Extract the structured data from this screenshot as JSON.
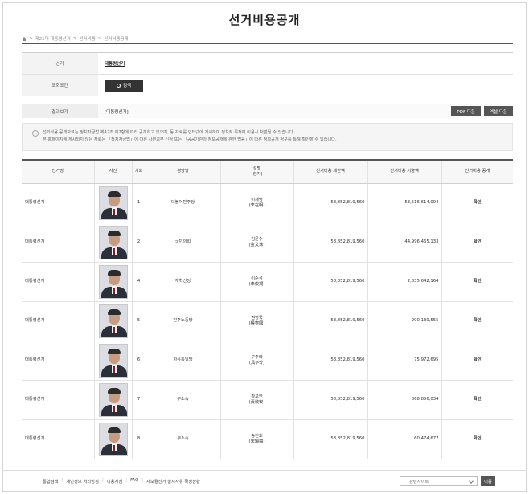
{
  "page": {
    "title": "선거비용공개"
  },
  "breadcrumb": [
    "제21대 대통령선거",
    "선거비용",
    "선거비용공개"
  ],
  "search": {
    "election_label": "선거",
    "election_value": "대통령선거",
    "condition_label": "조회조건",
    "search_button": "검색"
  },
  "result": {
    "label": "결과보기",
    "value": "[대통령선거]",
    "pdf_button": "PDF 다운",
    "excel_button": "엑셀 다운"
  },
  "notice": {
    "line1": "선거비용 공개자료는 정치자금법 제42조 제2항에 따라 공개하고 있으며, 동 자료를 인터넷에 게시하여 정치적 목적에 이용시 처벌될 수 있습니다.",
    "line2": "본 홈페이지에 게시되지 않은 자료는 「정치자금법」에 따른 사본교부 신청 또는 「공공기관의 정보공개에 관한 법률」에 따른 정보공개 청구를 통해 확인할 수 있습니다."
  },
  "table": {
    "headers": {
      "election": "선거명",
      "photo": "사진",
      "number": "기호",
      "party": "정당명",
      "name": "성명",
      "name_sub": "(한자)",
      "limit": "선거비용 제한액",
      "spent": "선거비용 지출액",
      "disclose": "선거비용 공개"
    },
    "rows": [
      {
        "election": "대통령선거",
        "number": "1",
        "party": "더불어민주당",
        "name": "이재명",
        "hanja": "(李在明)",
        "limit": "58,852,819,560",
        "spent": "53,516,614,094",
        "link": "확인"
      },
      {
        "election": "대통령선거",
        "number": "2",
        "party": "국민의힘",
        "name": "김문수",
        "hanja": "(金文洙)",
        "limit": "58,852,819,560",
        "spent": "44,996,465,133",
        "link": "확인"
      },
      {
        "election": "대통령선거",
        "number": "4",
        "party": "개혁신당",
        "name": "이준석",
        "hanja": "(李俊錫)",
        "limit": "58,852,819,560",
        "spent": "2,835,642,164",
        "link": "확인"
      },
      {
        "election": "대통령선거",
        "number": "5",
        "party": "민주노동당",
        "name": "권영국",
        "hanja": "(權寧國)",
        "limit": "58,852,819,560",
        "spent": "990,139,555",
        "link": "확인"
      },
      {
        "election": "대통령선거",
        "number": "6",
        "party": "자유통일당",
        "name": "구주와",
        "hanja": "(具주와)",
        "limit": "58,852,819,560",
        "spent": "75,972,695",
        "link": "확인"
      },
      {
        "election": "대통령선거",
        "number": "7",
        "party": "무소속",
        "name": "황교안",
        "hanja": "(黃敎安)",
        "limit": "58,852,819,560",
        "spent": "868,856,034",
        "link": "확인"
      },
      {
        "election": "대통령선거",
        "number": "8",
        "party": "무소속",
        "name": "송진호",
        "hanja": "(宋鎭鎬)",
        "limit": "58,852,819,560",
        "spent": "60,474,677",
        "link": "확인"
      }
    ]
  },
  "footer": {
    "links": [
      "통합검색",
      "개인정보 처리방침",
      "이용지침",
      "FAQ",
      "재보궐선거 실시사유 확정상황"
    ],
    "site_select": "관련사이트",
    "go_button": "이동"
  }
}
